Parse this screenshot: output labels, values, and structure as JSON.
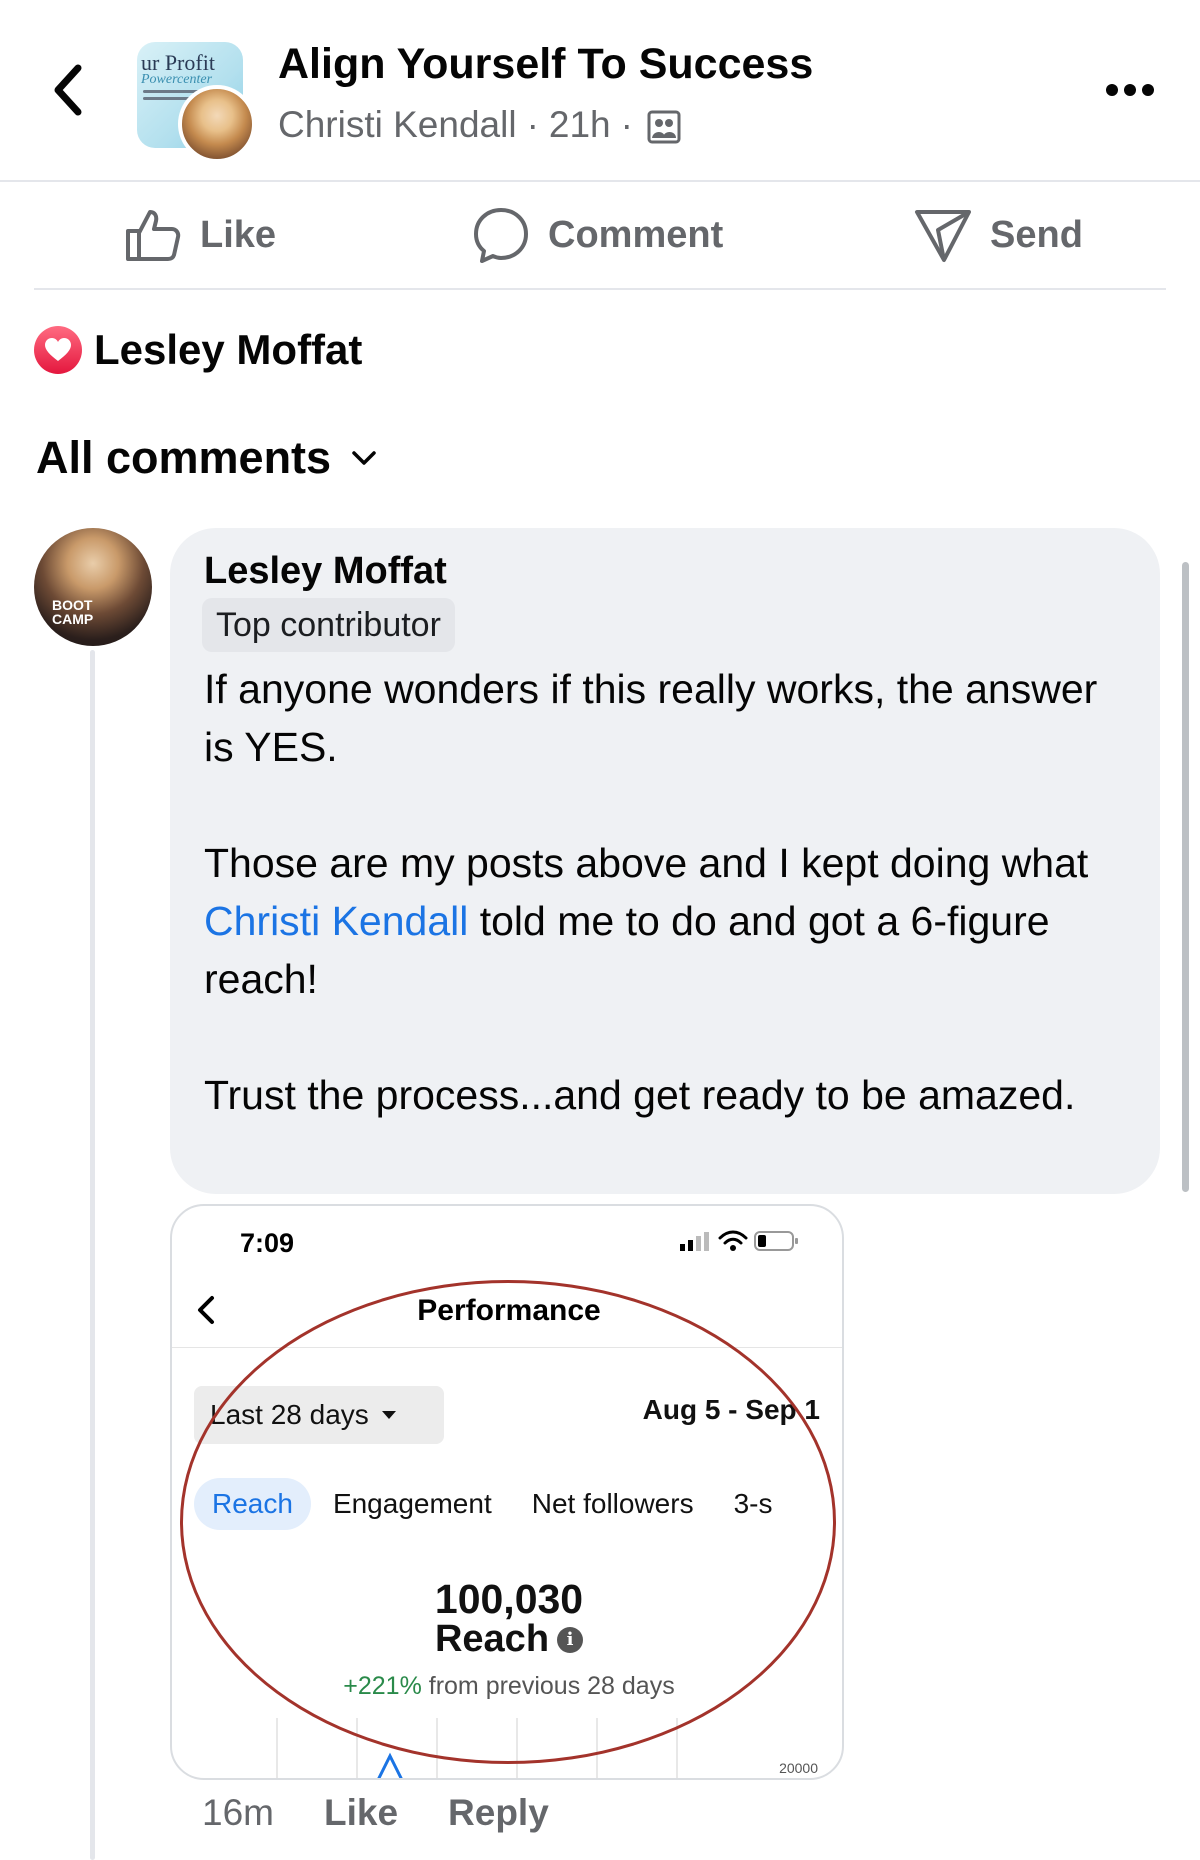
{
  "header": {
    "title": "Align Yourself To Success",
    "author": "Christi Kendall",
    "time": "21h",
    "group_thumb_text": "ur Profit",
    "group_thumb_sub": "Powercenter"
  },
  "actions": {
    "like_label": "Like",
    "comment_label": "Comment",
    "send_label": "Send"
  },
  "reactions": {
    "names": "Lesley Moffat",
    "type": "love",
    "color": "#e4173e"
  },
  "comments_filter": {
    "label": "All comments"
  },
  "comment": {
    "author": "Lesley Moffat",
    "badge": "Top contributor",
    "avatar_text": "BOOT CAMP",
    "para1": "If anyone wonders if this really works, the answer is YES.",
    "para2_before": "Those are my posts above and I kept doing what ",
    "para2_mention": "Christi Kendall",
    "para2_after": " told me to do and got a 6-figure reach!",
    "para3": "Trust the process...and get ready to be amazed.",
    "time": "16m",
    "like_label": "Like",
    "reply_label": "Reply"
  },
  "attachment": {
    "status_time": "7:09",
    "title": "Performance",
    "range_label": "Last 28 days",
    "dates": "Aug 5 - Sep 1",
    "tabs": [
      "Reach",
      "Engagement",
      "Net followers",
      "3-s"
    ],
    "active_tab": "Reach",
    "metric_value": "100,030",
    "metric_label": "Reach",
    "change_pct": "+221%",
    "change_text": " from previous 28 days",
    "axis_label": "20000",
    "annotation_color": "#a3332b"
  },
  "colors": {
    "link": "#1b74e4",
    "secondary_text": "#65676b",
    "bubble": "#eff1f4",
    "positive": "#2a8a4a"
  }
}
